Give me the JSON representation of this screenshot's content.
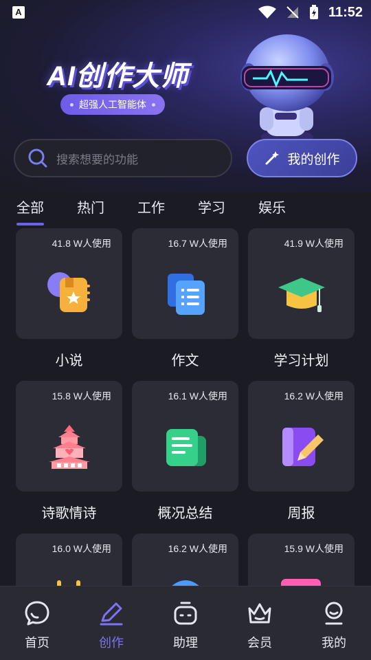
{
  "status_bar": {
    "time": "11:52",
    "left_icon_glyph": "A"
  },
  "hero": {
    "title": "AI创作大师",
    "subtitle": "超强人工智能体"
  },
  "search": {
    "placeholder": "搜索想要的功能"
  },
  "my_creation_label": "我的创作",
  "tabs": [
    {
      "label": "全部",
      "active": true
    },
    {
      "label": "热门",
      "active": false
    },
    {
      "label": "工作",
      "active": false
    },
    {
      "label": "学习",
      "active": false
    },
    {
      "label": "娱乐",
      "active": false
    }
  ],
  "cards": [
    {
      "usage": "41.8 W人使用",
      "label": "小说",
      "icon": "novel-icon"
    },
    {
      "usage": "16.7 W人使用",
      "label": "作文",
      "icon": "essay-icon"
    },
    {
      "usage": "41.9 W人使用",
      "label": "学习计划",
      "icon": "graduation-cap-icon"
    },
    {
      "usage": "15.8 W人使用",
      "label": "诗歌情诗",
      "icon": "pavilion-icon"
    },
    {
      "usage": "16.1 W人使用",
      "label": "概况总结",
      "icon": "summary-doc-icon"
    },
    {
      "usage": "16.2 W人使用",
      "label": "周报",
      "icon": "report-pen-icon"
    },
    {
      "usage": "16.0 W人使用",
      "label": "",
      "icon": "partial-icon"
    },
    {
      "usage": "16.2 W人使用",
      "label": "",
      "icon": "partial-icon"
    },
    {
      "usage": "15.9 W人使用",
      "label": "",
      "icon": "partial-icon"
    }
  ],
  "bottom_nav": [
    {
      "label": "首页",
      "icon": "chat-bubble-icon",
      "active": false
    },
    {
      "label": "创作",
      "icon": "pen-icon",
      "active": true
    },
    {
      "label": "助理",
      "icon": "robot-face-icon",
      "active": false
    },
    {
      "label": "会员",
      "icon": "crown-icon",
      "active": false
    },
    {
      "label": "我的",
      "icon": "profile-icon",
      "active": false
    }
  ],
  "colors": {
    "accent": "#6b63ea",
    "background": "#1b1b24",
    "card": "#2c2c37"
  }
}
